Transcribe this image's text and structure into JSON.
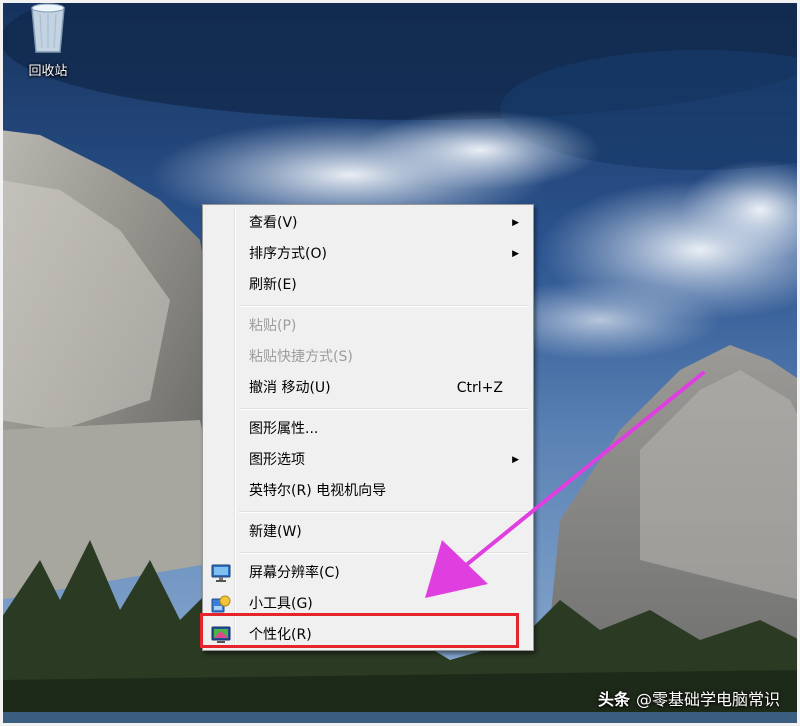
{
  "desktop": {
    "recycle_bin_label": "回收站"
  },
  "context_menu": {
    "items": [
      {
        "label": "查看(V)",
        "submenu": true
      },
      {
        "label": "排序方式(O)",
        "submenu": true
      },
      {
        "label": "刷新(E)"
      },
      {
        "label": "粘贴(P)",
        "disabled": true
      },
      {
        "label": "粘贴快捷方式(S)",
        "disabled": true
      },
      {
        "label": "撤消 移动(U)",
        "shortcut": "Ctrl+Z"
      },
      {
        "label": "图形属性..."
      },
      {
        "label": "图形选项",
        "submenu": true
      },
      {
        "label": "英特尔(R) 电视机向导"
      },
      {
        "label": "新建(W)"
      },
      {
        "label": "屏幕分辨率(C)",
        "icon": "monitor-icon"
      },
      {
        "label": "小工具(G)",
        "icon": "gadgets-icon"
      },
      {
        "label": "个性化(R)",
        "icon": "personalize-icon",
        "highlighted": true
      }
    ],
    "submenu_glyph": "▶"
  },
  "annotation": {
    "highlight_color": "#e5242b",
    "arrow_color": "#e040e0"
  },
  "watermark": {
    "brand": "头条",
    "text": "@零基础学电脑常识"
  }
}
